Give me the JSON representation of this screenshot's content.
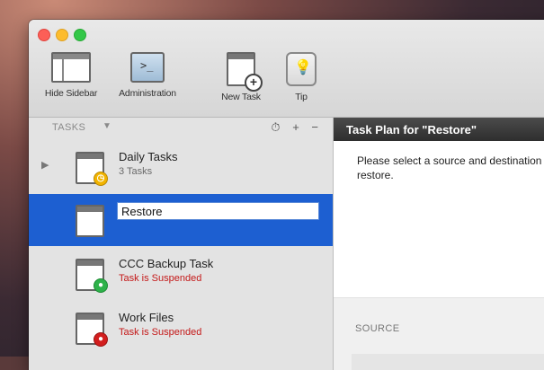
{
  "toolbar": {
    "hide_sidebar": "Hide Sidebar",
    "administration": "Administration",
    "new_task": "New Task",
    "tip": "Tip"
  },
  "sidebar": {
    "header": "TASKS",
    "tools": [
      "⏱",
      "+",
      "−"
    ],
    "tasks": [
      {
        "name": "Daily Tasks",
        "sub": "3 Tasks",
        "badge": "yellow"
      },
      {
        "name": "Restore",
        "sub": "",
        "badge": ""
      },
      {
        "name": "CCC Backup Task",
        "sub": "Task is Suspended",
        "badge": "green"
      },
      {
        "name": "Work Files",
        "sub": "Task is Suspended",
        "badge": "red"
      }
    ]
  },
  "main": {
    "title": "Task Plan for \"Restore\"",
    "message": "Please select a source and destination to restore.",
    "source_label": "SOURCE"
  }
}
